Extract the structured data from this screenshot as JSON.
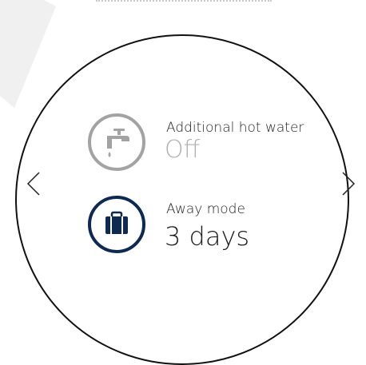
{
  "navigation": {
    "prev_icon": "chevron-left-icon",
    "next_icon": "chevron-right-icon"
  },
  "items": [
    {
      "icon": "faucet-icon",
      "label": "Additional hot water",
      "value": "Off",
      "state": "off",
      "icon_color": "#a3a3a3",
      "value_color": "#b0b0b0"
    },
    {
      "icon": "suitcase-icon",
      "label": "Away mode",
      "value": "3 days",
      "state": "active",
      "icon_color": "#0f2a51",
      "value_color": "#1c1c1c"
    }
  ],
  "colors": {
    "ring": "#000000",
    "background": "#ffffff",
    "active": "#0f2a51",
    "inactive": "#a3a3a3"
  }
}
